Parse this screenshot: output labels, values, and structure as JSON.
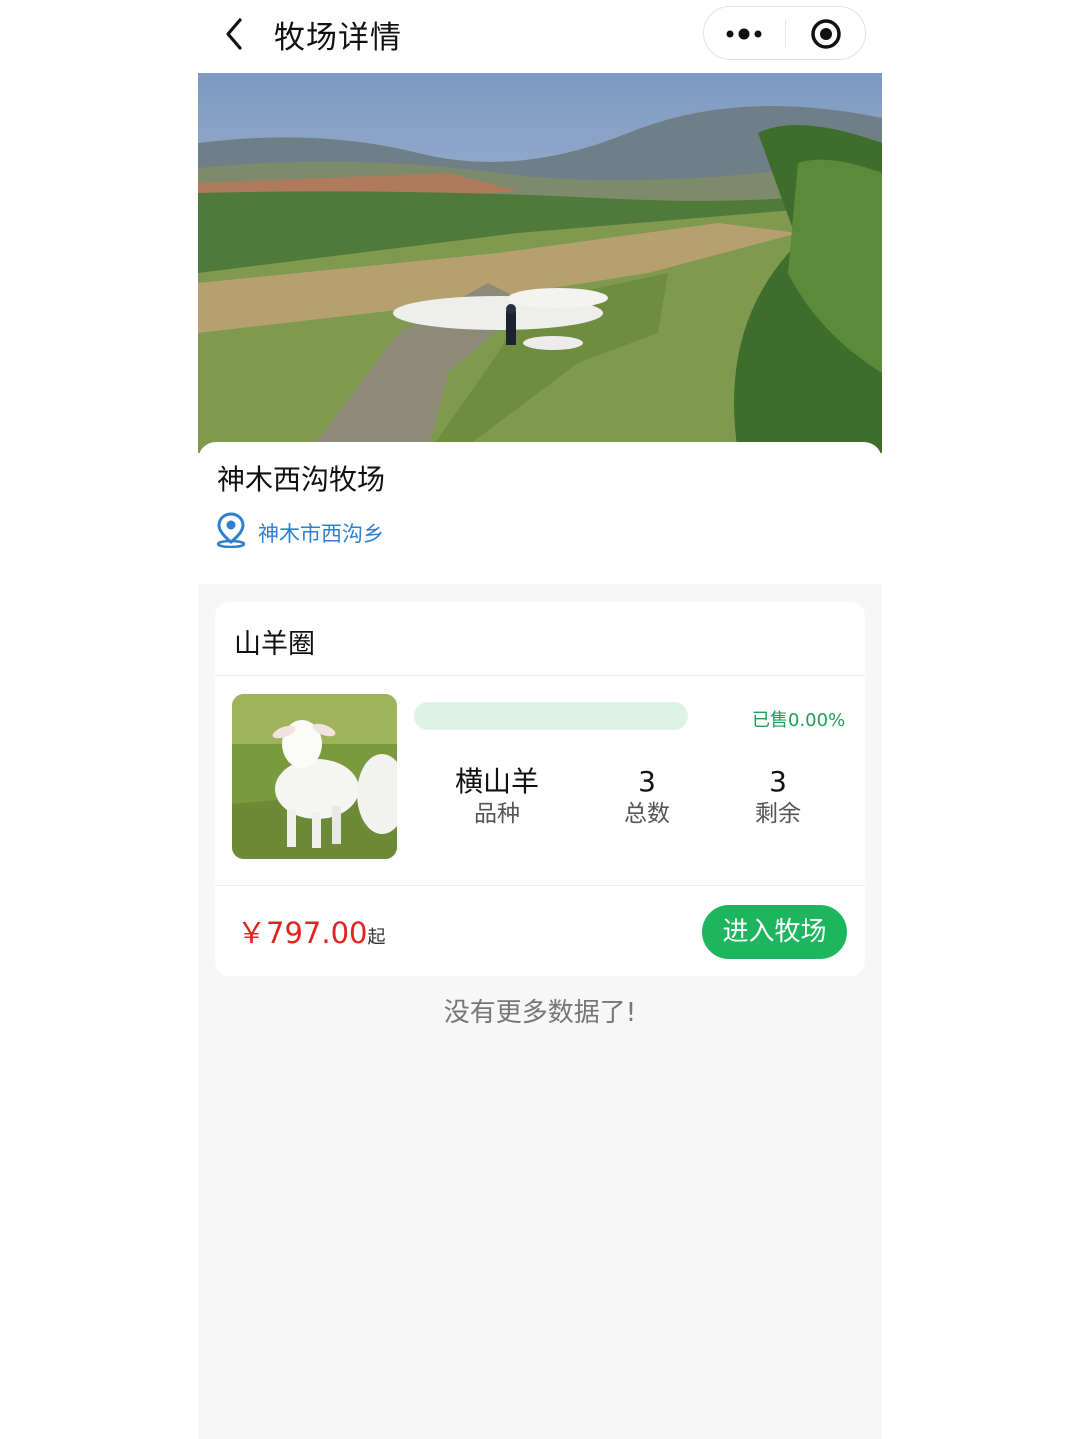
{
  "nav": {
    "title": "牧场详情"
  },
  "farm": {
    "name": "神木西沟牧场",
    "location": "神木市西沟乡"
  },
  "pen": {
    "title": "山羊圈",
    "sold_label": "已售0.00%",
    "sold_fraction": 0.0,
    "stats": [
      {
        "value": "横山羊",
        "label": "品种"
      },
      {
        "value": "3",
        "label": "总数"
      },
      {
        "value": "3",
        "label": "剩余"
      }
    ],
    "price": "￥797.00",
    "price_suffix": "起",
    "enter_label": "进入牧场"
  },
  "footer": {
    "no_more": "没有更多数据了!"
  },
  "colors": {
    "accent": "#1db55d",
    "price": "#e0241f",
    "link": "#2f7fd1"
  }
}
